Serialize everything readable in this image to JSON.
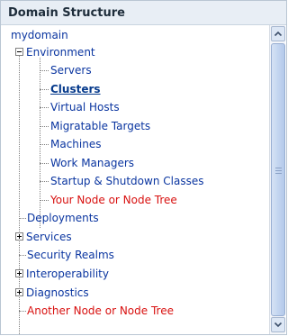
{
  "panel": {
    "title": "Domain Structure"
  },
  "tree": {
    "root": "mydomain",
    "environment": {
      "label": "Environment",
      "children": [
        "Servers",
        "Clusters",
        "Virtual Hosts",
        "Migratable Targets",
        "Machines",
        "Work Managers",
        "Startup & Shutdown Classes",
        "Your Node or Node Tree"
      ]
    },
    "top_items": [
      "Deployments",
      "Services",
      "Security Realms",
      "Interoperability",
      "Diagnostics",
      "Another Node or Node Tree"
    ]
  },
  "colors": {
    "link": "#0a35a0",
    "highlight": "#d8100f",
    "header_bg": "#e8eef5"
  },
  "icons": {
    "expand": "plus-box-icon",
    "collapse": "minus-box-icon",
    "scroll_up": "chevron-up-icon",
    "scroll_down": "chevron-down-icon"
  }
}
